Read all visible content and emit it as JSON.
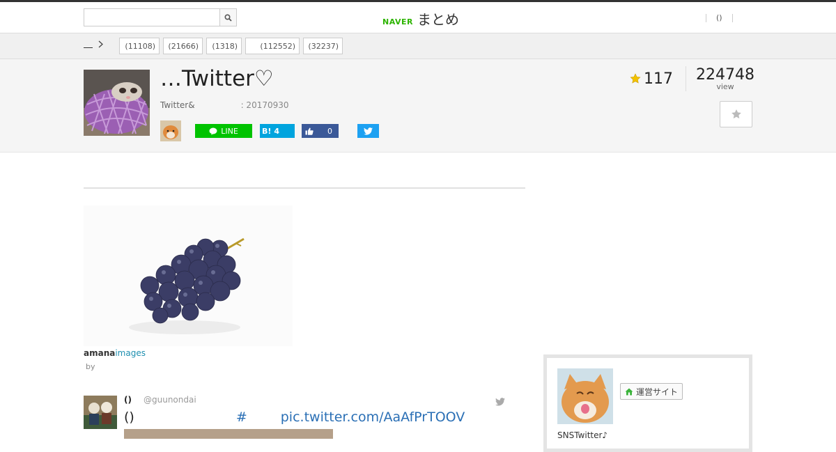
{
  "header": {
    "search_placeholder": "",
    "logo_naver": "NAVER",
    "logo_matome": "まとめ",
    "right_link": "()"
  },
  "breadcrumb": {
    "label": ""
  },
  "categories": [
    {
      "label": "(11108)"
    },
    {
      "label": "(21666)"
    },
    {
      "label": "(1318)"
    },
    {
      "label": "(112552)"
    },
    {
      "label": "(32237)"
    }
  ],
  "hero": {
    "title": "…Twitter♡",
    "subtitle": "Twitter&",
    "date": ": 20170930",
    "favorites": "117",
    "views": "224748",
    "views_label": "view"
  },
  "share": {
    "line_label": "LINE",
    "hatena_label": "B!",
    "hatena_count": "4",
    "facebook_count": "0"
  },
  "article": {
    "image_credit_a": "amana",
    "image_credit_b": "images",
    "by_label": "by"
  },
  "tweet": {
    "name": "()",
    "handle": "@guunondai",
    "text_prefix": "()",
    "hashtag": "#",
    "link": "pic.twitter.com/AaAfPrTOOV"
  },
  "sidebar": {
    "site_button": "運営サイト",
    "description": "SNSTwitter♪"
  },
  "colors": {
    "naver_green": "#2db400",
    "line_green": "#00c300",
    "hatena_blue": "#00a4de",
    "facebook_blue": "#3b5998",
    "twitter_blue": "#1da1f2",
    "star_yellow": "#f2c200",
    "link_blue": "#2a6fb5"
  }
}
